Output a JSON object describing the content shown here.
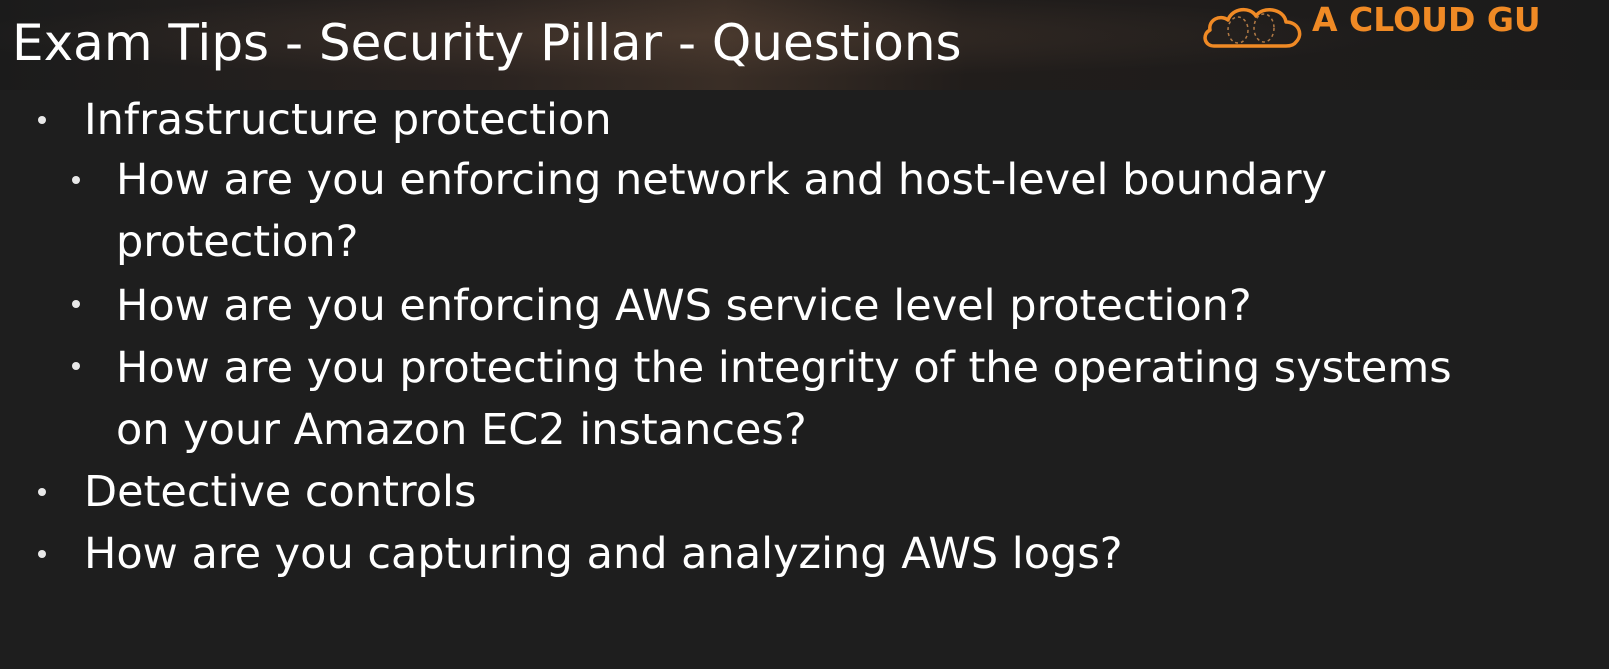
{
  "slide": {
    "title": "Exam Tips - Security Pillar - Questions"
  },
  "brand": {
    "text": "A CLOUD GU",
    "logo_icon": "cloud-logo-icon",
    "accent_color": "#f08a25"
  },
  "bullets": [
    {
      "level": 1,
      "text": "Infrastructure protection"
    },
    {
      "level": 2,
      "text": "How are you enforcing network and host-level boundary"
    },
    {
      "level": 2,
      "text": "protection?",
      "continuation": true
    },
    {
      "level": 2,
      "text": "How are you enforcing AWS service level protection?"
    },
    {
      "level": 2,
      "text": "How are you protecting the integrity of the operating systems"
    },
    {
      "level": 2,
      "text": "on your Amazon EC2 instances?",
      "continuation": true
    },
    {
      "level": 1,
      "text": "Detective controls"
    },
    {
      "level": 1,
      "text": "How are you capturing and analyzing AWS logs?"
    }
  ]
}
